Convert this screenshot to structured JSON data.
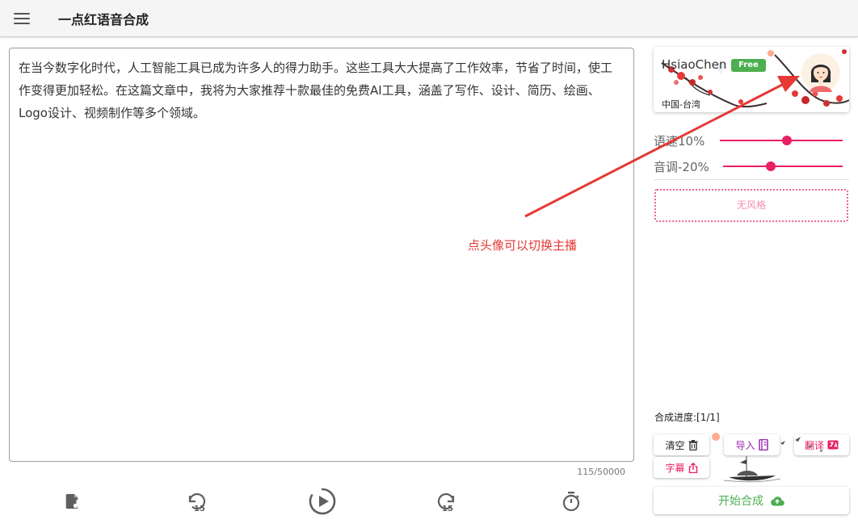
{
  "header": {
    "title": "一点红语音合成",
    "menu_icon": "hamburger-menu-icon"
  },
  "editor": {
    "text": "在当今数字化时代，人工智能工具已成为许多人的得力助手。这些工具大大提高了工作效率，节省了时间，使工作变得更加轻松。在这篇文章中，我将为大家推荐十款最佳的免费AI工具，涵盖了写作、设计、简历、绘画、Logo设计、视频制作等多个领域。",
    "char_count": "115/50000"
  },
  "player": {
    "controls": [
      {
        "name": "audio-file-icon"
      },
      {
        "name": "rewind-15-icon",
        "label": "15"
      },
      {
        "name": "play-icon"
      },
      {
        "name": "forward-15-icon",
        "label": "15"
      },
      {
        "name": "timer-icon"
      }
    ]
  },
  "voice": {
    "name": "HsiaoChen",
    "badge": "Free",
    "region": "中国-台湾"
  },
  "sliders": {
    "rate": {
      "label": "语速10%",
      "value_percent": 10,
      "position": 0.56
    },
    "pitch": {
      "label": "音调-20%",
      "value_percent": -20,
      "position": 0.4
    }
  },
  "style": {
    "label": "无风格"
  },
  "annotation": {
    "text": "点头像可以切换主播"
  },
  "progress": {
    "label": "合成进度:[1/1]"
  },
  "actions": {
    "clear": "清空",
    "import": "导入",
    "translate": "翻译",
    "subtitle": "字幕",
    "start": "开始合成"
  },
  "colors": {
    "accent": "#e91e63",
    "free_badge": "#4caf50",
    "start": "#4caf50",
    "annotation": "#e53935",
    "import": "#9c27b0",
    "subtitle": "#e91e63"
  }
}
